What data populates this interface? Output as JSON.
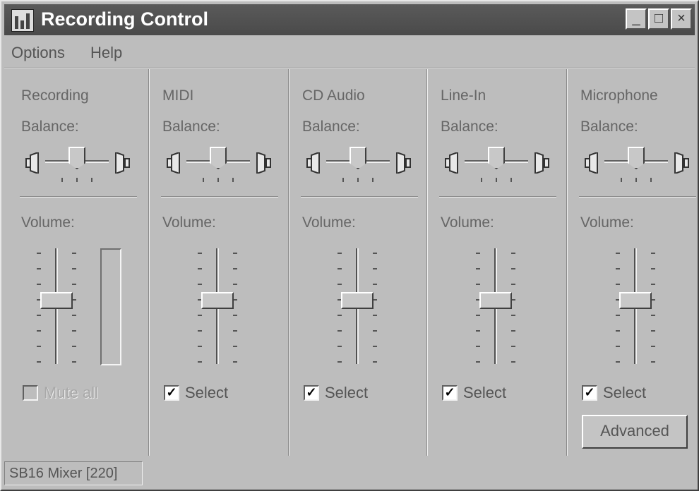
{
  "window": {
    "title": "Recording Control",
    "minimize_label": "_",
    "maximize_label": "□",
    "close_label": "×"
  },
  "menu": [
    {
      "label": "Options"
    },
    {
      "label": "Help"
    }
  ],
  "panels": [
    {
      "name": "Recording",
      "balance_label": "Balance:",
      "volume_label": "Volume:",
      "checkbox_label": "Mute all",
      "checked": false,
      "enabled": false,
      "volume_level": 0.55,
      "balance": 0.5
    },
    {
      "name": "MIDI",
      "balance_label": "Balance:",
      "volume_label": "Volume:",
      "checkbox_label": "Select",
      "checked": true,
      "enabled": true,
      "volume_level": 0.55,
      "balance": 0.5
    },
    {
      "name": "CD Audio",
      "balance_label": "Balance:",
      "volume_label": "Volume:",
      "checkbox_label": "Select",
      "checked": true,
      "enabled": true,
      "volume_level": 0.55,
      "balance": 0.5
    },
    {
      "name": "Line-In",
      "balance_label": "Balance:",
      "volume_label": "Volume:",
      "checkbox_label": "Select",
      "checked": true,
      "enabled": true,
      "volume_level": 0.55,
      "balance": 0.5
    },
    {
      "name": "Microphone",
      "balance_label": "Balance:",
      "volume_label": "Volume:",
      "checkbox_label": "Select",
      "checked": true,
      "enabled": true,
      "volume_level": 0.55,
      "balance": 0.5
    }
  ],
  "advanced_button": "Advanced",
  "status": "SB16 Mixer [220]",
  "check_glyph": "✓",
  "colors": {
    "titlebar": "#4a4a4a",
    "face": "#bdbdbd"
  }
}
